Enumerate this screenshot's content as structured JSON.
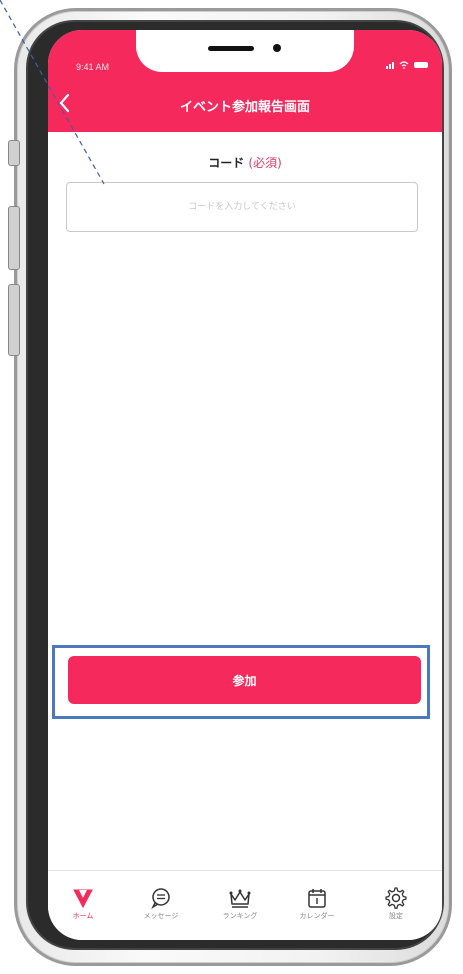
{
  "status_bar": {
    "time": "9:41 AM"
  },
  "header": {
    "title": "イベント参加報告画面",
    "back_icon": "back-chevron-icon"
  },
  "form": {
    "label": "コード",
    "required": "(必須)",
    "placeholder": "コードを入力してください",
    "value": ""
  },
  "join_button": {
    "label": "参加"
  },
  "tabbar": {
    "items": [
      {
        "label": "ホーム",
        "icon": "home-arrow-icon",
        "active": true
      },
      {
        "label": "メッセージ",
        "icon": "message-icon",
        "active": false
      },
      {
        "label": "ランキング",
        "icon": "crown-icon",
        "active": false
      },
      {
        "label": "カレンダー",
        "icon": "calendar-icon",
        "active": false
      },
      {
        "label": "設定",
        "icon": "gear-icon",
        "active": false
      }
    ]
  },
  "colors": {
    "accent": "#f5295b",
    "highlight": "#4c78c0",
    "annotation": "#3b5fa8"
  }
}
